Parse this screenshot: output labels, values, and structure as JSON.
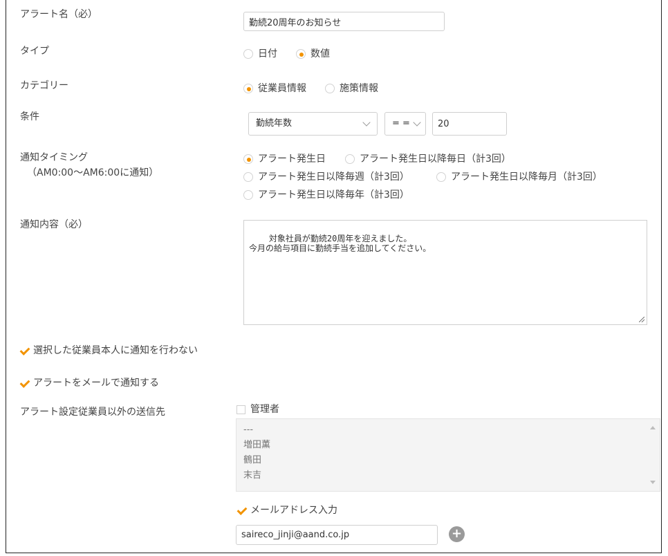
{
  "form": {
    "alert_name": {
      "label": "アラート名（必）",
      "value": "勤続20周年のお知らせ"
    },
    "type": {
      "label": "タイプ",
      "options": [
        "日付",
        "数値"
      ],
      "selected": "数値"
    },
    "category": {
      "label": "カテゴリー",
      "options": [
        "従業員情報",
        "施策情報"
      ],
      "selected": "従業員情報"
    },
    "condition": {
      "label": "条件",
      "field": "勤続年数",
      "operator": "= =",
      "value": "20"
    },
    "timing": {
      "label": "通知タイミング",
      "sublabel": "（AM0:00～AM6:00に通知）",
      "options": [
        "アラート発生日",
        "アラート発生日以降毎日（計3回）",
        "アラート発生日以降毎週（計3回）",
        "アラート発生日以降毎月（計3回）",
        "アラート発生日以降毎年（計3回）"
      ],
      "selected": "アラート発生日"
    },
    "content": {
      "label": "通知内容（必）",
      "value": "対象社員が勤続20周年を迎えました。\n今月の給与項目に勤続手当を追加してください。"
    },
    "no_notify_self": {
      "label": "選択した従業員本人に通知を行わない",
      "checked": true
    },
    "notify_mail": {
      "label": "アラートをメールで通知する",
      "checked": true
    },
    "recipients": {
      "label": "アラート設定従業員以外の送信先",
      "admin": {
        "label": "管理者",
        "checked": false
      },
      "list": [
        "---",
        "増田薫",
        "鶴田",
        "末吉"
      ],
      "mail_input": {
        "label": "メールアドレス入力",
        "checked": true
      },
      "email": "saireco_jinji@aand.co.jp",
      "add_symbol": "+"
    }
  },
  "colors": {
    "accent": "#f29300",
    "border": "#cfcfcf",
    "text": "#444444"
  }
}
